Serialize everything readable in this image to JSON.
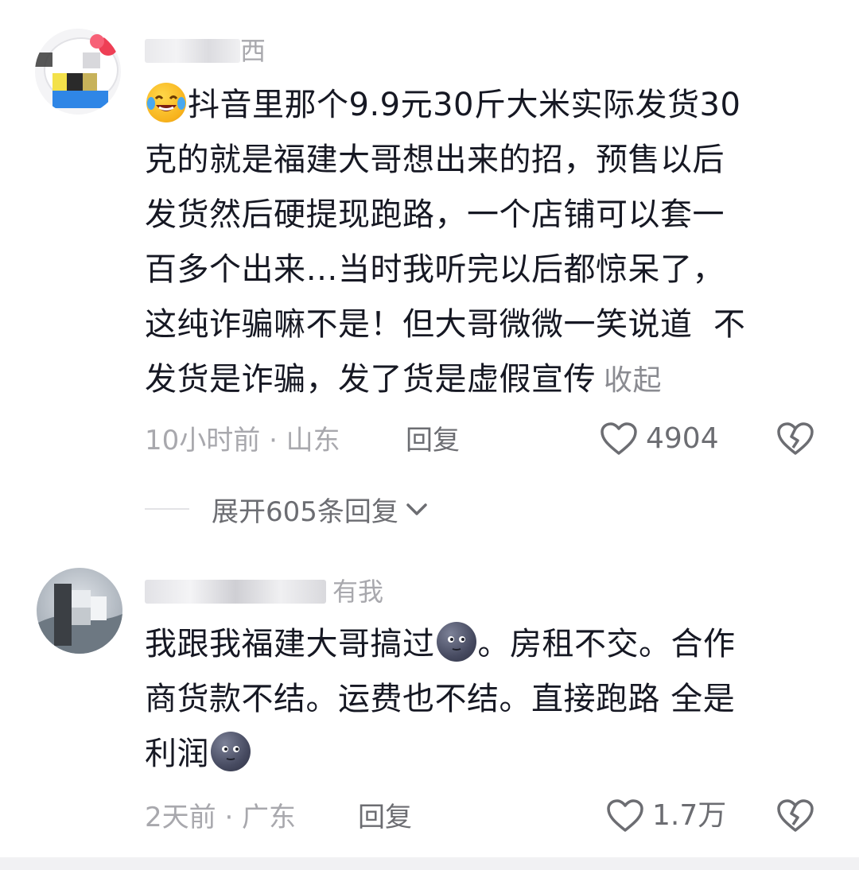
{
  "comments": [
    {
      "username": "西",
      "text_lines": [
        "抖音里那个9.9元30斤大米实际发货30",
        "克的就是福建大哥想出来的招，预售以后",
        "发货然后硬提现跑路，一个店铺可以套一",
        "百多个出来…当时我听完以后都惊呆了，",
        "这纯诈骗嘛不是！但大哥微微一笑说道  不",
        "发货是诈骗，发了货是虚假宣传"
      ],
      "leading_emoji": "laughing-tears-emoji",
      "collapse_label": "收起",
      "time_location": "10小时前 · 山东",
      "reply_label": "回复",
      "like_count": "4904",
      "expand_replies_label": "展开605条回复"
    },
    {
      "username": "有我",
      "text_segments": [
        "我跟我福建大哥搞过",
        "。房租不交。合作",
        "商货款不结。运费也不结。直接跑路 全是",
        "利润"
      ],
      "inline_emoji": "dark-moon-face-emoji",
      "time_location": "2天前 · 广东",
      "reply_label": "回复",
      "like_count": "1.7万"
    }
  ],
  "colors": {
    "text": "#161823",
    "muted": "#a8a8ad",
    "secondary": "#6c6d72"
  },
  "icons": {
    "like": "heart-outline-icon",
    "dislike": "broken-heart-icon",
    "expand": "chevron-down-icon"
  }
}
